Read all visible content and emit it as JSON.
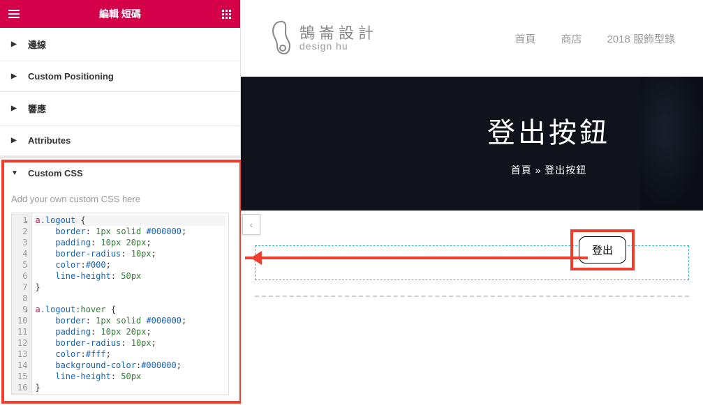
{
  "panel": {
    "title": "編輯 短碼",
    "sections": {
      "border": "邊線",
      "positioning": "Custom Positioning",
      "responsive": "響應",
      "attributes": "Attributes",
      "custom_css": "Custom CSS"
    },
    "css_hint": "Add your own custom CSS here"
  },
  "code": {
    "l1_sel": "a",
    "l1_cls": ".logout",
    "l1_brace": " {",
    "l2_p": "border",
    "l2_v1": "1px",
    "l2_v2": "solid",
    "l2_v3": "#000000",
    "l3_p": "padding",
    "l3_v1": "10px",
    "l3_v2": "20px",
    "l4_p": "border-radius",
    "l4_v1": "10px",
    "l5_p": "color",
    "l5_v1": "#000",
    "l6_p": "line-height",
    "l6_v1": "50px",
    "l7": "}",
    "l9_sel": "a",
    "l9_cls": ".logout",
    "l9_ps": ":hover",
    "l9_brace": " {",
    "l10_p": "border",
    "l10_v1": "1px",
    "l10_v2": "solid",
    "l10_v3": "#000000",
    "l11_p": "padding",
    "l11_v1": "10px",
    "l11_v2": "20px",
    "l12_p": "border-radius",
    "l12_v1": "10px",
    "l13_p": "color",
    "l13_v1": "#fff",
    "l14_p": "background-color",
    "l14_v1": "#000000",
    "l15_p": "line-height",
    "l15_v1": "50px",
    "l16": "}"
  },
  "site": {
    "logo_zh": "鵠崙設計",
    "logo_en": "design hu",
    "nav": {
      "home": "首頁",
      "shop": "商店",
      "catalog": "2018 服飾型錄"
    }
  },
  "hero": {
    "title": "登出按鈕",
    "bc_home": "首頁",
    "bc_sep": " » ",
    "bc_current": "登出按鈕"
  },
  "widget": {
    "logout_label": "登出"
  }
}
